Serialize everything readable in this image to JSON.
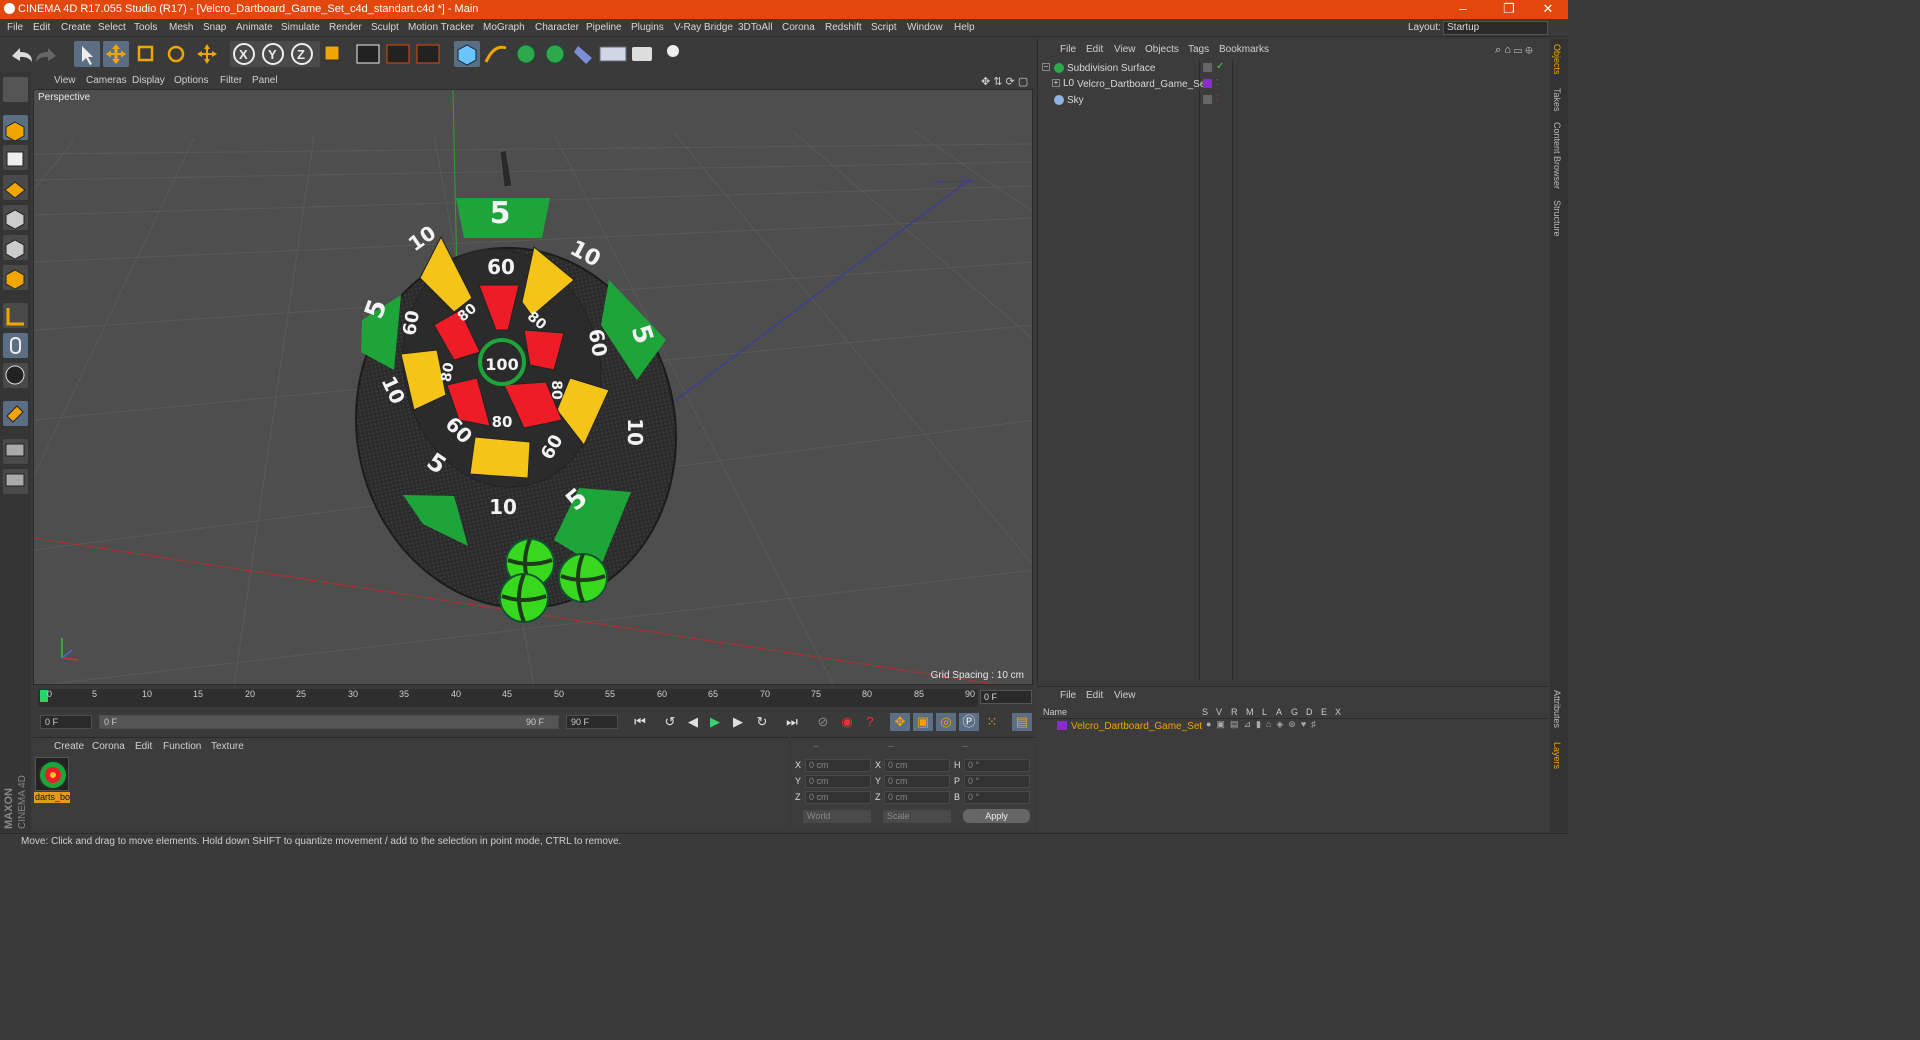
{
  "window": {
    "title": "CINEMA 4D R17.055 Studio (R17) - [Velcro_Dartboard_Game_Set_c4d_standart.c4d *] - Main",
    "minimize": "–",
    "restore": "❐",
    "close": "✕"
  },
  "menubar": {
    "items": [
      "File",
      "Edit",
      "Create",
      "Select",
      "Tools",
      "Mesh",
      "Snap",
      "Animate",
      "Simulate",
      "Render",
      "Sculpt",
      "Motion Tracker",
      "MoGraph",
      "Character",
      "Pipeline",
      "Plugins",
      "V-Ray Bridge",
      "3DToAll",
      "Corona",
      "Redshift",
      "Script",
      "Window",
      "Help"
    ],
    "layout_label": "Layout:",
    "layout_value": "Startup"
  },
  "toolbar": {
    "axis_x": "X",
    "axis_y": "Y",
    "axis_z": "Z"
  },
  "viewport": {
    "menu": [
      "View",
      "Cameras",
      "Display",
      "Options",
      "Filter",
      "Panel"
    ],
    "camera_label": "Perspective",
    "grid_spacing": "Grid Spacing : 10 cm"
  },
  "dartboard": {
    "outer_labels": [
      "5",
      "10",
      "5",
      "10",
      "5",
      "10",
      "5",
      "10",
      "5",
      "10"
    ],
    "inner_labels": [
      "60",
      "60",
      "60",
      "60",
      "60",
      "60"
    ],
    "mid_labels": [
      "80",
      "80",
      "80",
      "80",
      "80",
      "80"
    ],
    "bullseye": "100"
  },
  "timeline": {
    "ticks": [
      "0",
      "5",
      "10",
      "15",
      "20",
      "25",
      "30",
      "35",
      "40",
      "45",
      "50",
      "55",
      "60",
      "65",
      "70",
      "75",
      "80",
      "85",
      "90"
    ],
    "end_field": "0 F",
    "start_frame": "0 F",
    "range_start": "0 F",
    "range_end": "90 F",
    "max_frame": "90 F"
  },
  "material_manager": {
    "menu": [
      "Create",
      "Corona",
      "Edit",
      "Function",
      "Texture"
    ],
    "material_name": "darts_bo"
  },
  "coordinates": {
    "headers": [
      "--",
      "--",
      "--"
    ],
    "rows": [
      {
        "a": "X",
        "av": "0 cm",
        "b": "X",
        "bv": "0 cm",
        "c": "H",
        "cv": "0 °"
      },
      {
        "a": "Y",
        "av": "0 cm",
        "b": "Y",
        "bv": "0 cm",
        "c": "P",
        "cv": "0 °"
      },
      {
        "a": "Z",
        "av": "0 cm",
        "b": "Z",
        "bv": "0 cm",
        "c": "B",
        "cv": "0 °"
      }
    ],
    "world": "World",
    "scale": "Scale",
    "apply": "Apply"
  },
  "object_manager": {
    "menu": [
      "File",
      "Edit",
      "View",
      "Objects",
      "Tags",
      "Bookmarks"
    ],
    "objects": [
      {
        "name": "Subdivision Surface"
      },
      {
        "name": "Velcro_Dartboard_Game_Set"
      },
      {
        "name": "Sky"
      }
    ]
  },
  "layer_manager": {
    "menu": [
      "File",
      "Edit",
      "View"
    ],
    "columns": [
      "Name",
      "S",
      "V",
      "R",
      "M",
      "L",
      "A",
      "G",
      "D",
      "E",
      "X"
    ],
    "layer_name": "Velcro_Dartboard_Game_Set"
  },
  "right_tabs": [
    "Objects",
    "Takes",
    "Content Browser",
    "Structure",
    "Attributes",
    "Layers"
  ],
  "maxon": {
    "line1": "MAXON",
    "line2": "CINEMA 4D"
  },
  "status": "Move: Click and drag to move elements. Hold down SHIFT to quantize movement / add to the selection in point mode, CTRL to remove.",
  "colors": {
    "accent": "#e2470d",
    "selection": "#5b6e84",
    "layer_purple": "#8a2bd2",
    "material_orange": "#e79b1e"
  }
}
